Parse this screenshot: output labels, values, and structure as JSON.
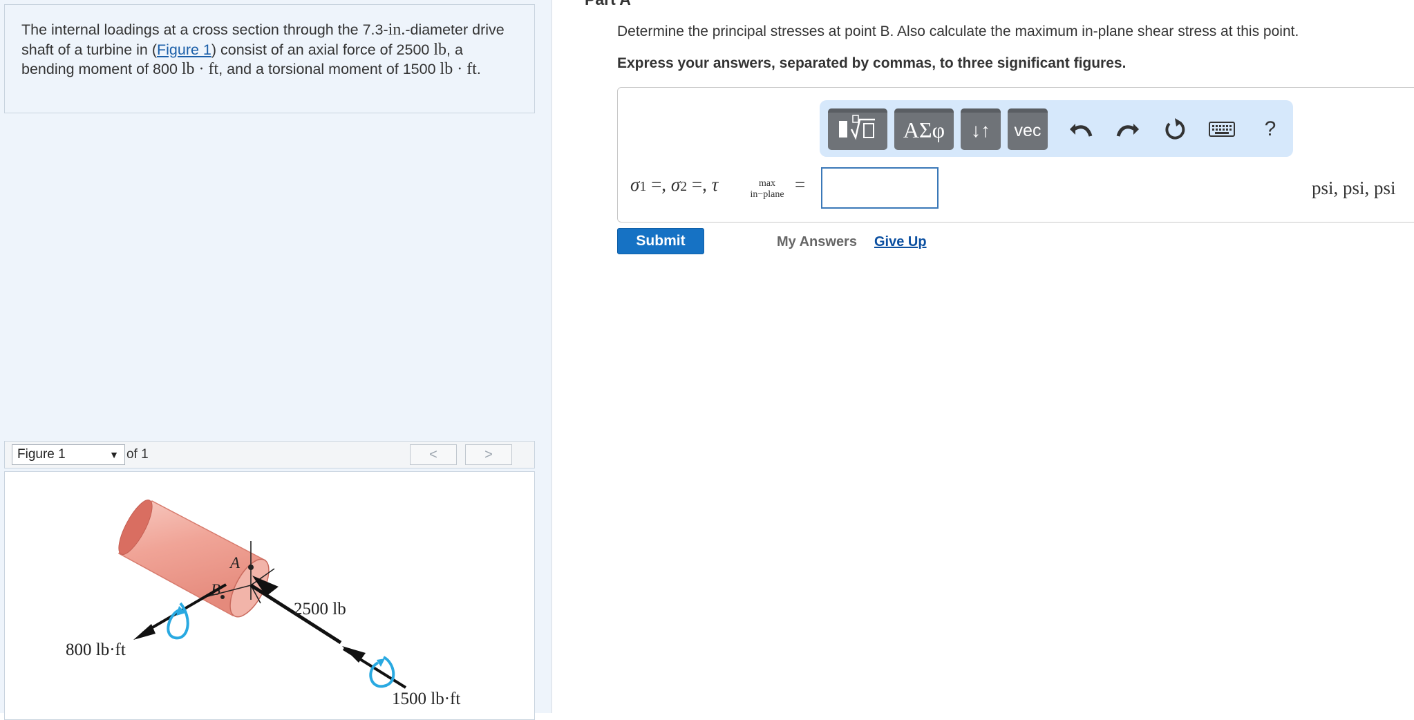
{
  "problem": {
    "t1": "The internal loadings at a cross section through the 7.3-",
    "u_in": "in.",
    "t2": "-diameter drive shaft of a turbine in (",
    "figure_link": "Figure 1",
    "t3": ") consist of an axial force of 2500 ",
    "u_lb": "lb",
    "t4": ", a bending moment of 800 ",
    "u_lbft1": "lb · ft",
    "t5": ", and a torsional moment of 1500 ",
    "u_lbft2": "lb · ft",
    "t6": "."
  },
  "figure_nav": {
    "selected": "Figure 1",
    "of_text": "of 1",
    "prev": "<",
    "next": ">"
  },
  "figure": {
    "label_A": "A",
    "label_B": "B",
    "force": "2500 lb",
    "bending": "800 lb·ft",
    "torsion": "1500 lb·ft"
  },
  "part": {
    "title": "Part A",
    "question": "Determine the principal stresses at point B. Also calculate the maximum in-plane shear stress at this point.",
    "instructions": "Express your answers, separated by commas, to three significant figures."
  },
  "toolbar": {
    "greek": "ΑΣφ",
    "sort": "↓↑",
    "vec": "vec",
    "help": "?"
  },
  "formula": {
    "s1": "σ",
    "s1_sub": "1",
    "sep1": " =, ",
    "s2": "σ",
    "s2_sub": "2",
    "sep2": " =, ",
    "tau": "τ",
    "max": "max",
    "inplane": "in−plane",
    "eq": "=",
    "units": "psi, psi, psi",
    "input_value": ""
  },
  "actions": {
    "submit": "Submit",
    "my_answers": "My Answers",
    "give_up": "Give Up"
  }
}
